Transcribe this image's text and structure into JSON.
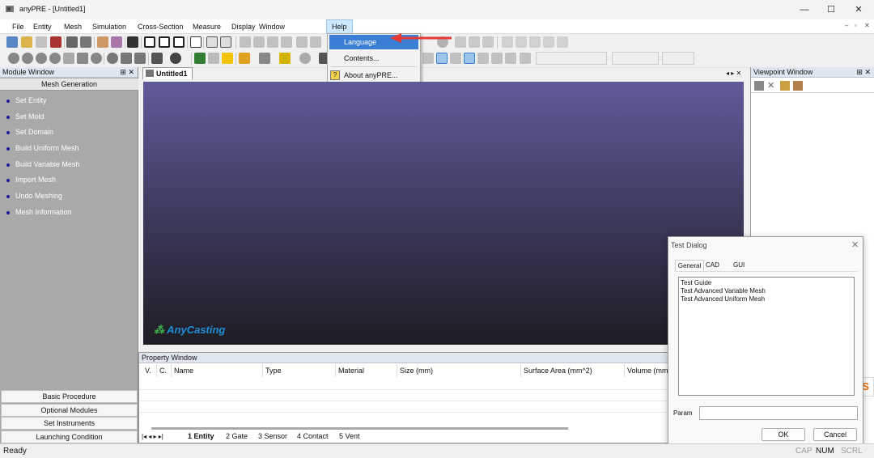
{
  "window": {
    "title": "anyPRE - [Untitled1]",
    "minimize": "—",
    "maximize": "☐",
    "close": "✕"
  },
  "menubar": {
    "items": [
      "File",
      "Entity",
      "Mesh",
      "Simulation",
      "Cross-Section",
      "Measure",
      "Display",
      "Window",
      "Help"
    ],
    "active": "Help"
  },
  "help_menu": {
    "items": [
      "Language",
      "Contents...",
      "About anyPRE..."
    ],
    "highlighted": "Language"
  },
  "module_window": {
    "title": "Module Window",
    "header": "Mesh Generation",
    "items": [
      "Set Entity",
      "Set Mold",
      "Set Domain",
      "Build Uniform Mesh",
      "Build Variable Mesh",
      "Import Mesh",
      "Undo Meshing",
      "Mesh Information"
    ],
    "bottom_buttons": [
      "Basic Procedure",
      "Optional Modules",
      "Set Instruments",
      "Launching Condition"
    ]
  },
  "document": {
    "tab": "Untitled1",
    "logo": "AnyCasting"
  },
  "property_window": {
    "title": "Property Window",
    "columns": [
      "V.",
      "C.",
      "Name",
      "Type",
      "Material",
      "Size (mm)",
      "Surface Area (mm^2)",
      "Volume (mm"
    ]
  },
  "sheet_tabs": [
    "1 Entity",
    "2 Gate",
    "3 Sensor",
    "4 Contact",
    "5 Vent"
  ],
  "viewpoint_window": {
    "title": "Viewpoint Window"
  },
  "dialog": {
    "title": "Test Dialog",
    "tabs": [
      "General",
      "CAD",
      "GUI"
    ],
    "list": [
      "Test Guide",
      "Test Advanced Variable Mesh",
      "Test Advanced Uniform Mesh"
    ],
    "param_label": "Param",
    "param_value": "",
    "ok": "OK",
    "cancel": "Cancel"
  },
  "statusbar": {
    "text": "Ready",
    "indicators": [
      "CAP",
      "NUM",
      "SCRL"
    ]
  },
  "colors": {
    "accent": "#3a7fd5",
    "arrow": "#e53935",
    "logo": "#1e8fd6"
  }
}
